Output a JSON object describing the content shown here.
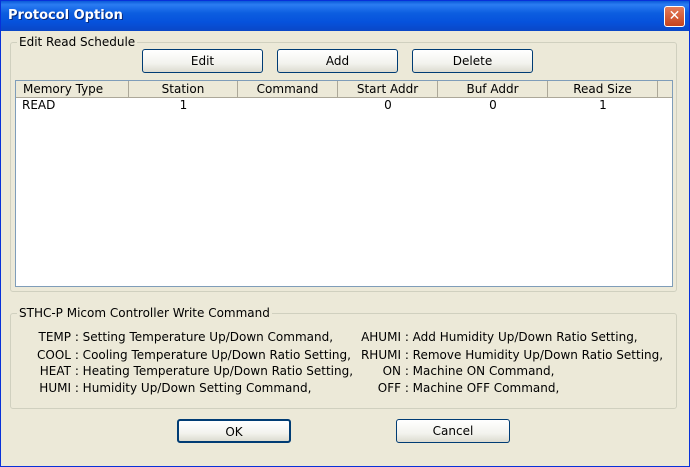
{
  "window": {
    "title": "Protocol Option",
    "close_glyph": "✕"
  },
  "edit_group": {
    "legend": "Edit Read Schedule",
    "buttons": {
      "edit": "Edit",
      "add": "Add",
      "delete": "Delete"
    }
  },
  "list": {
    "columns": [
      "Memory Type",
      "Station",
      "Command",
      "Start Addr",
      "Buf Addr",
      "Read Size"
    ],
    "rows": [
      {
        "memory_type": "READ",
        "station": "1",
        "command": "",
        "start_addr": "0",
        "buf_addr": "0",
        "read_size": "1"
      }
    ]
  },
  "commands": {
    "legend": "STHC-P Micom Controller Write Command",
    "left": [
      {
        "code": "TEMP",
        "desc": ": Setting Temperature Up/Down Command,"
      },
      {
        "code": "COOL",
        "desc": ": Cooling Temperature Up/Down Ratio Setting,"
      },
      {
        "code": "HEAT",
        "desc": ": Heating Temperature Up/Down Ratio Setting,"
      },
      {
        "code": "HUMI",
        "desc": ": Humidity Up/Down Setting Command,"
      }
    ],
    "right": [
      {
        "code": "AHUMI",
        "desc": ": Add Humidity Up/Down Ratio Setting,"
      },
      {
        "code": "RHUMI",
        "desc": ": Remove Humidity Up/Down Ratio Setting,"
      },
      {
        "code": "ON",
        "desc": ": Machine ON Command,"
      },
      {
        "code": "OFF",
        "desc": ": Machine OFF Command,"
      }
    ]
  },
  "footer": {
    "ok": "OK",
    "cancel": "Cancel"
  }
}
